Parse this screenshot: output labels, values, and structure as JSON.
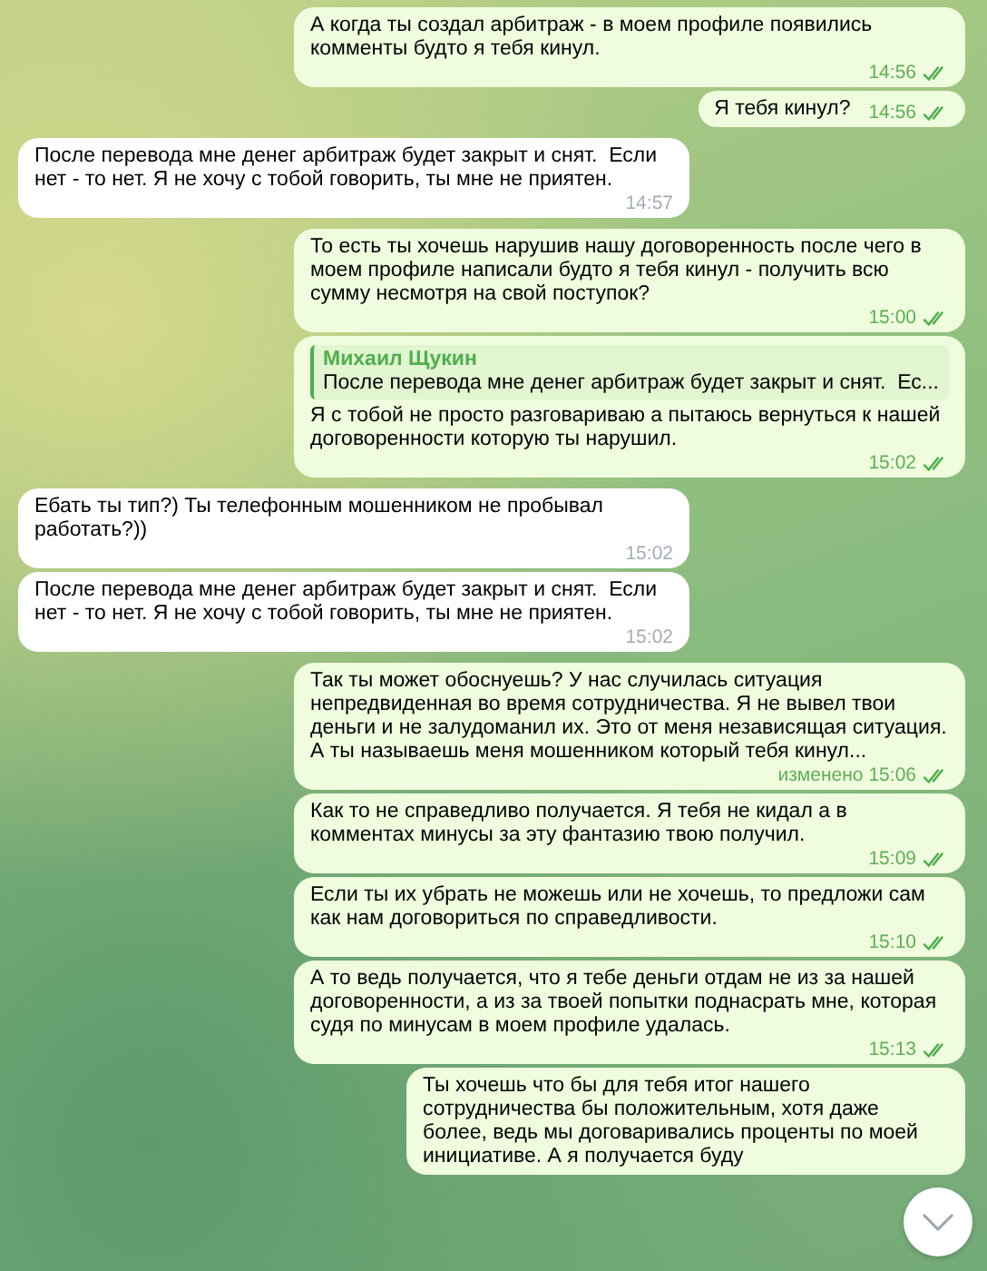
{
  "messages": [
    {
      "kind": "outgoing",
      "text": "А когда ты создал арбитраж - в моем профиле появились комменты будто я тебя кинул.",
      "time": "14:56",
      "read": true
    },
    {
      "kind": "outgoing",
      "text": "Я тебя кинул?",
      "time": "14:56",
      "read": true
    },
    {
      "kind": "incoming",
      "text": "После перевода мне денег арбитраж будет закрыт и снят.  Если нет - то нет. Я не хочу с тобой говорить, ты мне не приятен.",
      "time": "14:57"
    },
    {
      "kind": "outgoing",
      "text": "То есть ты хочешь нарушив нашу договоренность после чего в моем профиле написали будто я тебя кинул - получить всю сумму несмотря на свой поступок?",
      "time": "15:00",
      "read": true
    },
    {
      "kind": "outgoing",
      "reply": {
        "author": "Михаил Щукин",
        "text": "После перевода мне денег арбитраж будет закрыт и снят.  Ес..."
      },
      "text": "Я с тобой не просто разговариваю а пытаюсь вернуться к нашей договоренности которую ты нарушил.",
      "time": "15:02",
      "read": true
    },
    {
      "kind": "incoming",
      "text": "Ебать ты тип?) Ты телефонным мошенником не пробывал работать?))",
      "time": "15:02"
    },
    {
      "kind": "incoming",
      "text": "После перевода мне денег арбитраж будет закрыт и снят.  Если нет - то нет. Я не хочу с тобой говорить, ты мне не приятен.",
      "time": "15:02"
    },
    {
      "kind": "outgoing",
      "text": "Так ты может обоснуешь? У нас случилась ситуация непредвиденная во время сотрудничества. Я не вывел твои деньги и не залудоманил их. Это от меня независящая ситуация. А ты называешь меня мошенником который тебя кинул...",
      "edited": "изменено",
      "time": "15:06",
      "read": true
    },
    {
      "kind": "outgoing",
      "text": "Как то не справедливо получается. Я тебя не кидал а в комментах минусы за эту фантазию твою получил.",
      "time": "15:09",
      "read": true
    },
    {
      "kind": "outgoing",
      "text": "Если ты их убрать не можешь или не хочешь, то предложи сам как нам договориться по справедливости.",
      "time": "15:10",
      "read": true
    },
    {
      "kind": "outgoing",
      "text": "А то ведь получается, что я тебе деньги отдам не из за нашей договоренности, а из за твоей попытки поднасрать мне, которая судя по минусам в моем профиле удалась.",
      "time": "15:13",
      "read": true
    },
    {
      "kind": "outgoing",
      "text": "Ты хочешь что бы для тебя итог нашего сотрудничества бы положительным, хотя даже более, ведь мы договаривались проценты по моей инициативе. А я получается буду"
    }
  ]
}
